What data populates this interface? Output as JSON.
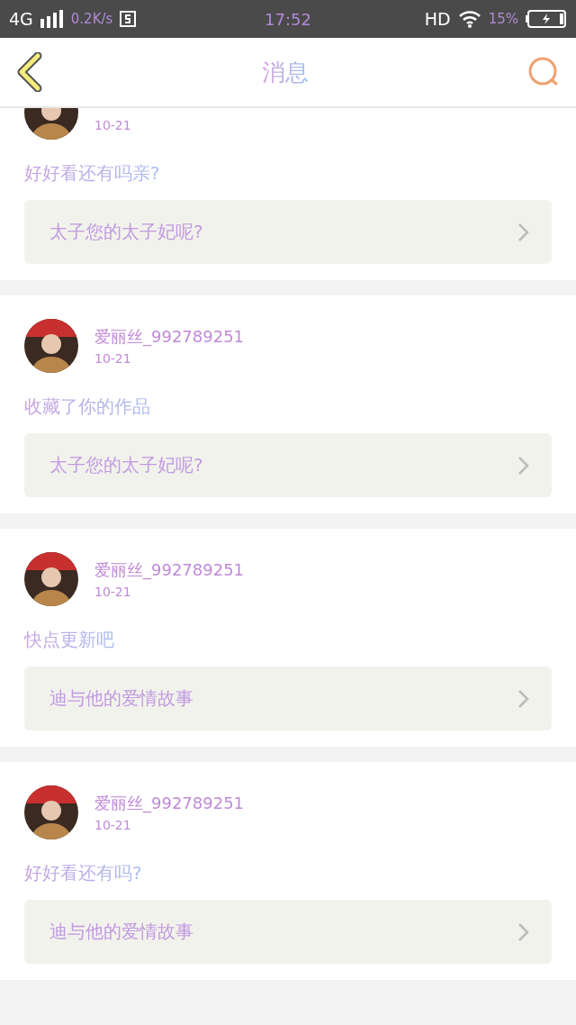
{
  "status_bar": {
    "network": "4G",
    "speed": "0.2K/s",
    "time": "17:52",
    "hd": "HD",
    "battery": "15%"
  },
  "header": {
    "title": "消息"
  },
  "messages": [
    {
      "date": "10-21",
      "text": "好好看还有吗亲?",
      "work": "太子您的太子妃呢?"
    },
    {
      "name": "爱丽丝_992789251",
      "date": "10-21",
      "text": "收藏了你的作品",
      "work": "太子您的太子妃呢?"
    },
    {
      "name": "爱丽丝_992789251",
      "date": "10-21",
      "text": "快点更新吧",
      "work": "迪与他的爱情故事"
    },
    {
      "name": "爱丽丝_992789251",
      "date": "10-21",
      "text": "好好看还有吗?",
      "work": "迪与他的爱情故事"
    }
  ]
}
